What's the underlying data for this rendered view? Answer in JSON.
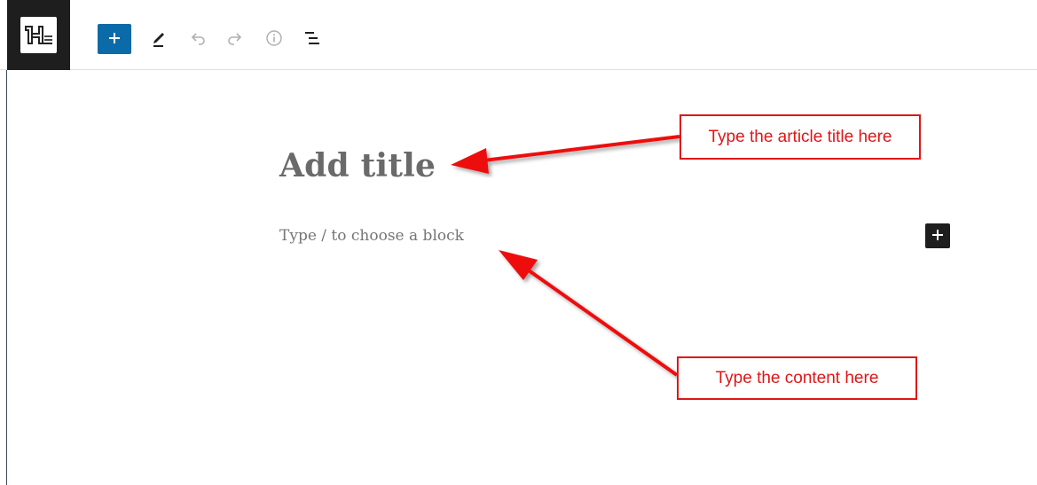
{
  "toolbar": {
    "logo_icon": "site-logo-icon",
    "inserter_icon": "plus-icon",
    "tools_icon": "pencil-icon",
    "undo_icon": "undo-icon",
    "redo_icon": "redo-icon",
    "details_icon": "info-icon",
    "list_view_icon": "list-view-icon",
    "accent_color": "#0b6aa8"
  },
  "editor": {
    "title_placeholder": "Add title",
    "block_placeholder": "Type / to choose a block",
    "block_add_icon": "plus-icon"
  },
  "annotations": {
    "title_note": "Type the article title here",
    "content_note": "Type the content here",
    "color": "#e01616"
  }
}
